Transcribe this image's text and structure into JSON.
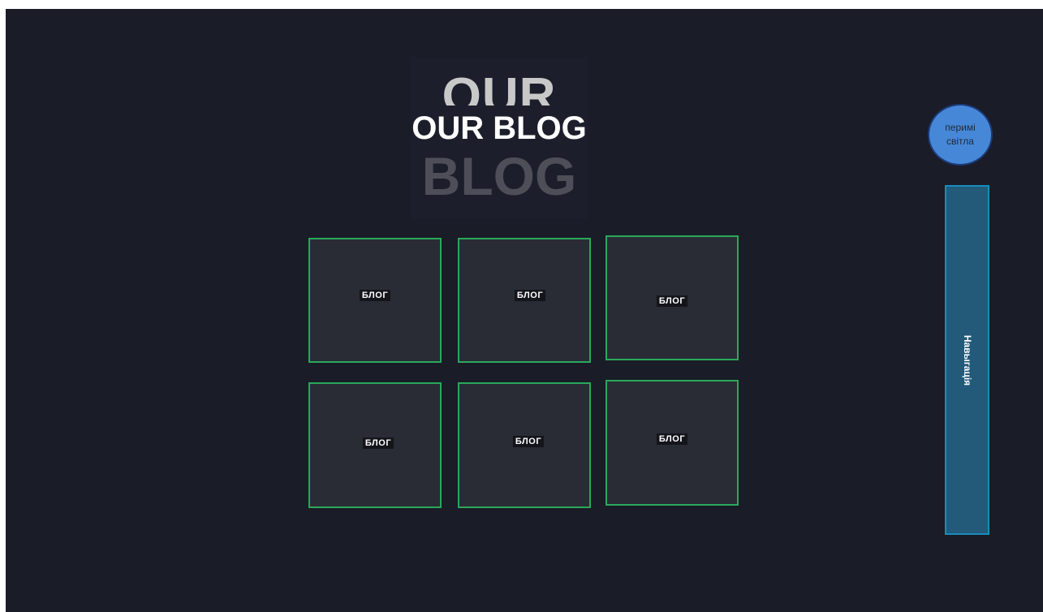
{
  "header": {
    "title_back_top": "OUR",
    "title_main": "OUR BLOG",
    "title_back_bottom": "BLOG"
  },
  "theme_toggle": {
    "label": "перимі світла"
  },
  "navigation": {
    "label": "Навыгація"
  },
  "blog_cards": [
    {
      "label": "БЛОГ"
    },
    {
      "label": "БЛОГ"
    },
    {
      "label": "БЛОГ"
    },
    {
      "label": "БЛОГ"
    },
    {
      "label": "БЛОГ"
    },
    {
      "label": "БЛОГ"
    }
  ],
  "colors": {
    "background": "#1a1c27",
    "card_background": "#292c35",
    "card_border": "#2aa85b",
    "toggle": "#4688d7",
    "nav_panel": "#235a7a"
  }
}
